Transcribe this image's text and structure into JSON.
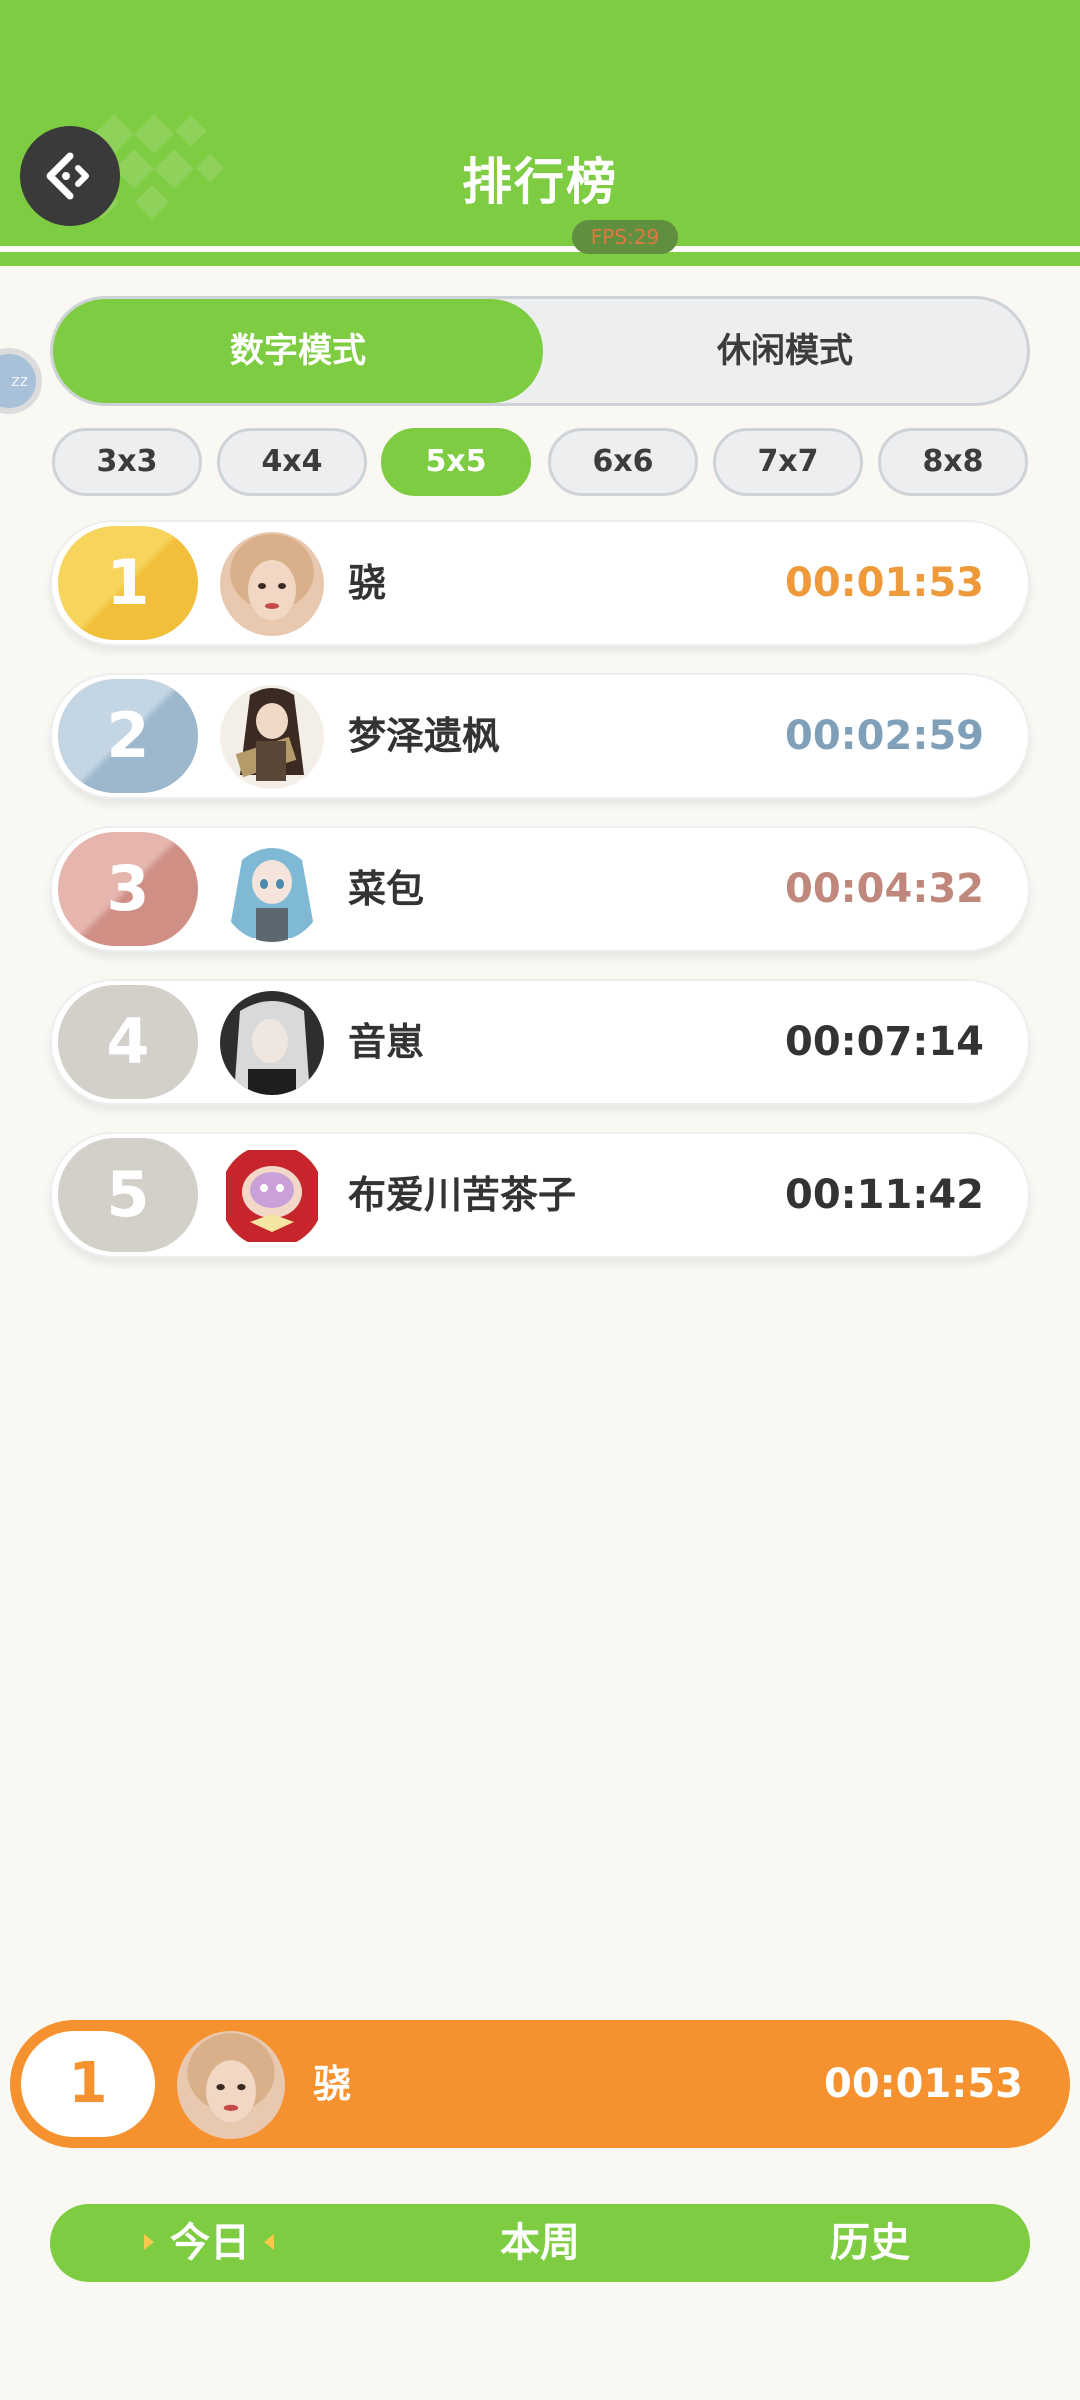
{
  "header": {
    "title": "排行榜",
    "fps_label": "FPS:29"
  },
  "side_token_text": "zz",
  "modes": {
    "active": "数字模式",
    "inactive": "休闲模式"
  },
  "sizes": [
    "3x3",
    "4x4",
    "5x5",
    "6x6",
    "7x7",
    "8x8"
  ],
  "selected_size": "5x5",
  "leaderboard": [
    {
      "rank": "1",
      "name": "骁",
      "time": "00:01:53"
    },
    {
      "rank": "2",
      "name": "梦泽遗枫",
      "time": "00:02:59"
    },
    {
      "rank": "3",
      "name": "菜包",
      "time": "00:04:32"
    },
    {
      "rank": "4",
      "name": "音崽",
      "time": "00:07:14"
    },
    {
      "rank": "5",
      "name": "布爱川苦茶子",
      "time": "00:11:42"
    }
  ],
  "my_rank": {
    "rank": "1",
    "name": "骁",
    "time": "00:01:53"
  },
  "periods": {
    "today": "今日",
    "week": "本周",
    "history": "历史",
    "selected": "今日"
  },
  "colors": {
    "brand_green": "#7ecc42",
    "gold": "#f5c84a",
    "silver": "#a2bccf",
    "bronze": "#d2968c",
    "plain_rank": "#d2d0c8",
    "my_bar": "#f5922f",
    "time_gold": "#ef9a3a",
    "time_silver": "#7fa0b8",
    "time_bronze": "#c0877c",
    "time_plain": "#333333"
  },
  "icons": {
    "back": "back-arrow-icon",
    "period_marker": "triangle-marker-icon"
  }
}
